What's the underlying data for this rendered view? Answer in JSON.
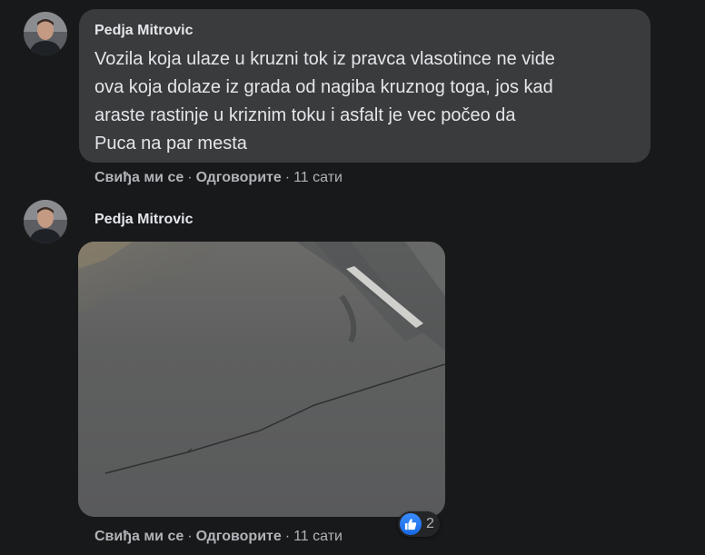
{
  "colors": {
    "background": "#18191a",
    "bubble": "#3a3b3c",
    "secondary_text": "#b0b3b8",
    "like_blue": "#2d88ff"
  },
  "comments": [
    {
      "author": "Pedja Mitrovic",
      "text": "Vozila koja ulaze u kruzni tok iz pravca vlasotince ne vide\nova koja dolaze iz grada od nagiba kruznog toga, jos kad\naraste rastinje u kriznim toku i asfalt je vec počeo da\nPuca na par mesta",
      "actions": {
        "like": "Свиђа ми се",
        "reply": "Одговорите",
        "time": "11 сати"
      }
    },
    {
      "author": "Pedja Mitrovic",
      "image": "photo of cracked asphalt road",
      "actions": {
        "like": "Свиђа ми се",
        "reply": "Одговорите",
        "time": "11 сати"
      },
      "reactions": {
        "icon": "like-icon",
        "count": "2"
      }
    }
  ],
  "separator": "·"
}
